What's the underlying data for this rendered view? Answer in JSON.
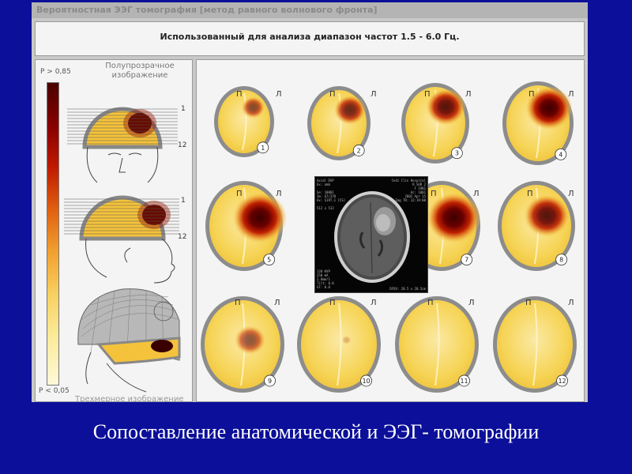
{
  "window_title": "Вероятностная ЭЭГ томография [метод равного волнового фронта]",
  "frequency_text": "Использованный для анализа диапазон частот 1.5 - 6.0 Гц.",
  "scale": {
    "top": "P > 0,85",
    "bottom": "P < 0,05"
  },
  "semi_transparent_label": "Полупрозрачное изображение",
  "slice_range": {
    "top": "1",
    "bottom": "12"
  },
  "bottom_panel_text": "Трехмерное изображение",
  "hemisphere_labels": {
    "left": "П",
    "right": "Л"
  },
  "slices": [
    {
      "num": "1",
      "intensity": 0.55
    },
    {
      "num": "2",
      "intensity": 0.7
    },
    {
      "num": "3",
      "intensity": 0.8
    },
    {
      "num": "4",
      "intensity": 0.9
    },
    {
      "num": "5",
      "intensity": 0.95
    },
    {
      "num": "7",
      "intensity": 0.95
    },
    {
      "num": "8",
      "intensity": 0.8
    },
    {
      "num": "9",
      "intensity": 0.5
    },
    {
      "num": "10",
      "intensity": 0.1
    },
    {
      "num": "11",
      "intensity": 0.05
    },
    {
      "num": "12",
      "intensity": 0.05
    }
  ],
  "ct_info": {
    "left": "Axial DSP\nEx: amb\n\nSe: 10001\nIm: 67/370\nAx: S19T.1 [CS]\n\n512 x 512",
    "right": "Cedi Clin Hospital\nR SUR 2\nF 1981\nAc: 1001\n2002 Apr 15\nImg TR: 12:19:00",
    "bottom_left": "120 KVP\n250 mA\n2.0mm/1\nTilt: 0.0\nGT: 0.0",
    "bottom_right": "DFOV: 20.5 x 20.5cm"
  },
  "caption": "Сопоставление анатомической и ЭЭГ- томографии",
  "colors": {
    "background": "#0b0f99",
    "window": "#c8c8c8",
    "panel": "#f4f4f4",
    "map_base": "#f7d24a",
    "map_hot": "#6a0000"
  }
}
